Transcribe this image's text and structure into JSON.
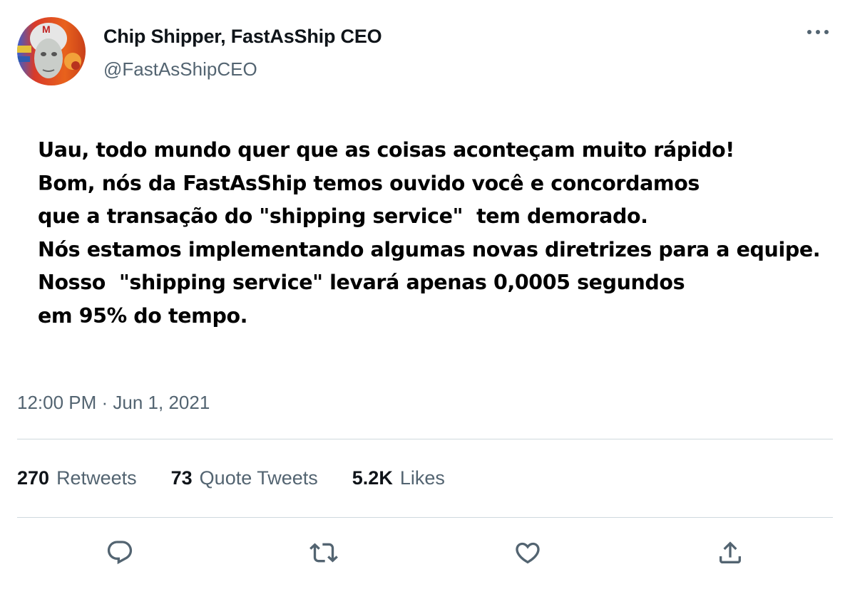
{
  "tweet": {
    "author": {
      "display_name": "Chip Shipper, FastAsShip CEO",
      "handle": "@FastAsShipCEO",
      "avatar_icon": "cartoon-racer-avatar"
    },
    "text_lines": [
      "Uau, todo mundo quer que as coisas aconteçam muito rápido!",
      "Bom, nós da FastAsShip temos ouvido você e concordamos",
      "que a transação do \"shipping service\"  tem demorado.",
      "Nós estamos implementando algumas novas diretrizes para a equipe.",
      "Nosso  \"shipping service\" levará apenas 0,0005 segundos",
      "em 95% do tempo."
    ],
    "timestamp": "12:00 PM · Jun 1, 2021",
    "stats": {
      "retweets": {
        "count": "270",
        "label": "Retweets"
      },
      "quote_tweets": {
        "count": "73",
        "label": "Quote Tweets"
      },
      "likes": {
        "count": "5.2K",
        "label": "Likes"
      }
    },
    "actions": {
      "reply_icon": "reply-icon",
      "retweet_icon": "retweet-icon",
      "like_icon": "heart-icon",
      "share_icon": "share-icon",
      "more_icon": "more-icon"
    }
  },
  "colors": {
    "text_primary": "#0f1419",
    "text_secondary": "#536471",
    "divider": "#cfd9de",
    "icon": "#536471"
  }
}
